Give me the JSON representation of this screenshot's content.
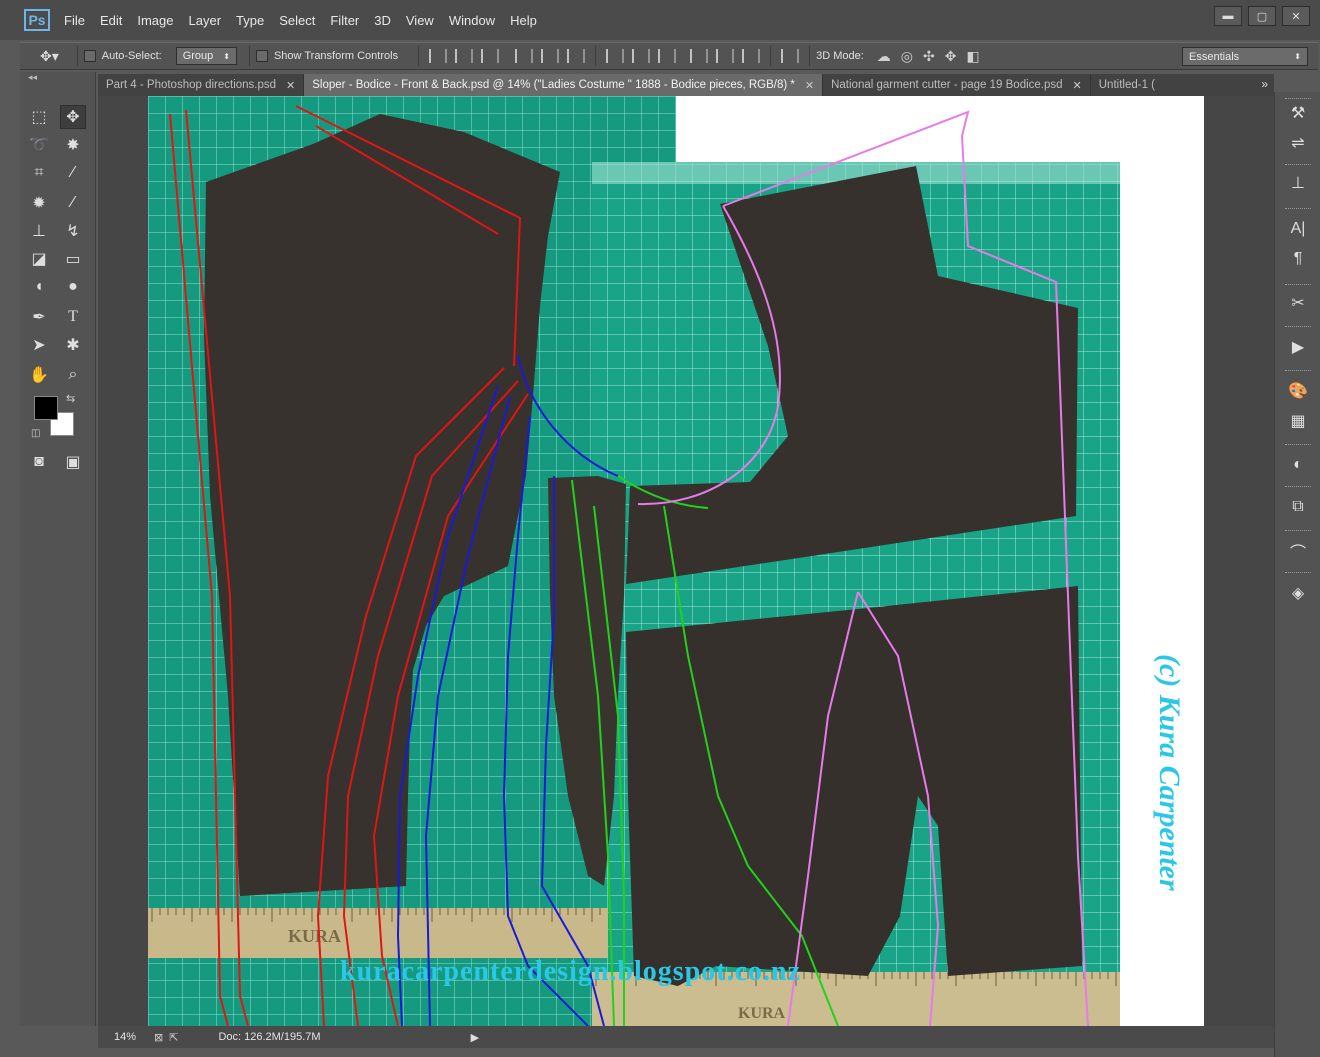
{
  "app": {
    "logo": "Ps"
  },
  "menu": [
    "File",
    "Edit",
    "Image",
    "Layer",
    "Type",
    "Select",
    "Filter",
    "3D",
    "View",
    "Window",
    "Help"
  ],
  "window_controls": {
    "minimize": "▬",
    "maximize": "▢",
    "close": "✕"
  },
  "options": {
    "auto_select_label": "Auto-Select:",
    "auto_select_value": "Group",
    "show_transform_label": "Show Transform Controls",
    "mode_label": "3D Mode:",
    "workspace": "Essentials"
  },
  "tabs": [
    {
      "label": "Part 4 - Photoshop directions.psd",
      "active": false
    },
    {
      "label": "Sloper - Bodice - Front & Back.psd @ 14% (\"Ladies Costume \" 1888 - Bodice pieces, RGB/8) *",
      "active": true
    },
    {
      "label": "National garment cutter - page 19 Bodice.psd",
      "active": false
    },
    {
      "label": "Untitled-1 (",
      "active": false
    }
  ],
  "document": {
    "watermark_url": "kuracarpenterdesign.blogspot.co.nz",
    "watermark_copyright": "(c) Kura Carpenter",
    "ruler_brand": "KURA"
  },
  "colors": {
    "mat_green": "#169a7f",
    "fabric": "#37322d",
    "line_red": "#e01515",
    "line_blue": "#1a1ad8",
    "line_green": "#22d11c",
    "line_pink": "#e77ae8",
    "watermark": "#2bc7e6"
  },
  "status": {
    "zoom": "14%",
    "doc_size": "Doc: 126.2M/195.7M"
  }
}
